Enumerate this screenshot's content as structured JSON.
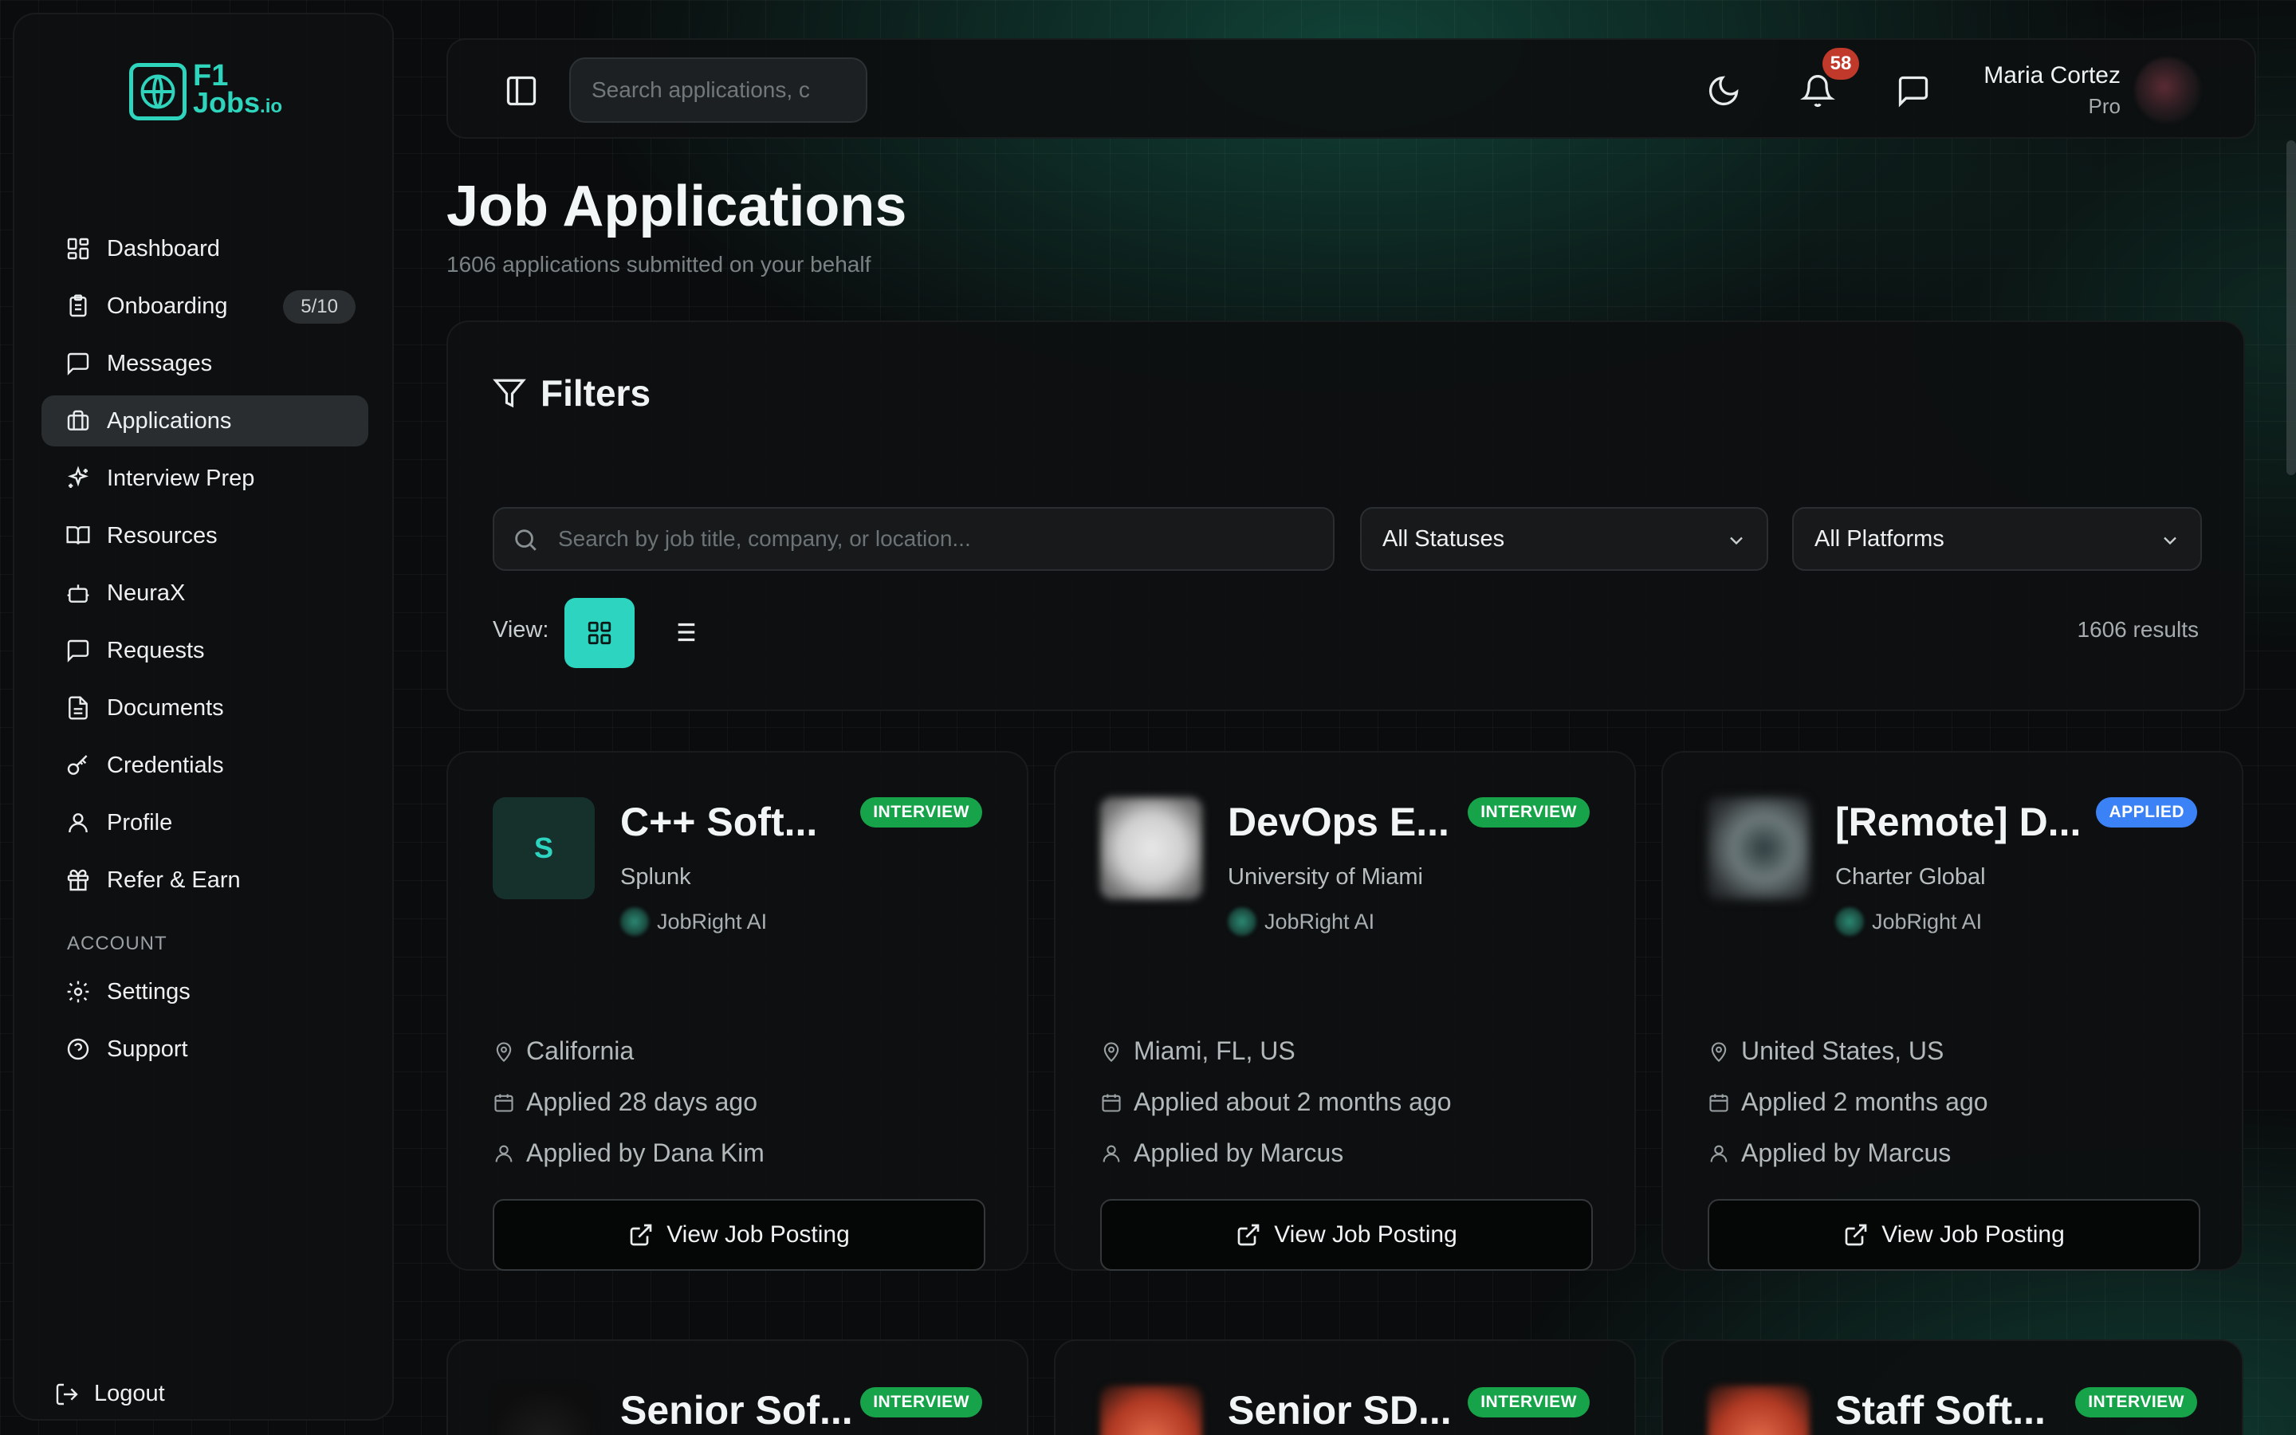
{
  "logo": {
    "line1": "F1",
    "line2": "Jobs",
    "suffix": ".io"
  },
  "sidebar": {
    "items": [
      {
        "label": "Dashboard",
        "icon": "dashboard-icon"
      },
      {
        "label": "Onboarding",
        "icon": "clipboard-icon",
        "badge": "5/10"
      },
      {
        "label": "Messages",
        "icon": "message-icon"
      },
      {
        "label": "Applications",
        "icon": "briefcase-icon",
        "active": true
      },
      {
        "label": "Interview Prep",
        "icon": "sparkles-icon"
      },
      {
        "label": "Resources",
        "icon": "book-icon"
      },
      {
        "label": "NeuraX",
        "icon": "bot-icon"
      },
      {
        "label": "Requests",
        "icon": "message-square-icon"
      },
      {
        "label": "Documents",
        "icon": "file-icon"
      },
      {
        "label": "Credentials",
        "icon": "key-icon"
      },
      {
        "label": "Profile",
        "icon": "user-icon"
      },
      {
        "label": "Refer & Earn",
        "icon": "gift-icon"
      }
    ],
    "account_section": "ACCOUNT",
    "account_items": [
      {
        "label": "Settings",
        "icon": "gear-icon"
      },
      {
        "label": "Support",
        "icon": "help-icon"
      }
    ],
    "logout": "Logout"
  },
  "header": {
    "search_placeholder": "Search applications, c",
    "notifications_count": "58",
    "user_name": "Maria Cortez",
    "user_plan": "Pro"
  },
  "page": {
    "title": "Job Applications",
    "subtitle": "1606 applications submitted on your behalf"
  },
  "filters": {
    "title": "Filters",
    "search_placeholder": "Search by job title, company, or location...",
    "status_select": "All Statuses",
    "platform_select": "All Platforms",
    "view_label": "View:",
    "results": "1606 results"
  },
  "cards": [
    {
      "title": "C++ Soft...",
      "status": "INTERVIEW",
      "company": "Splunk",
      "source": "JobRight AI",
      "logo_letter": "S",
      "location": "California",
      "applied": "Applied 28 days ago",
      "applied_by": "Applied by Dana Kim",
      "button": "View Job Posting"
    },
    {
      "title": "DevOps E...",
      "status": "INTERVIEW",
      "company": "University of Miami",
      "source": "JobRight AI",
      "location": "Miami, FL, US",
      "applied": "Applied about 2 months ago",
      "applied_by": "Applied by Marcus",
      "button": "View Job Posting"
    },
    {
      "title": "[Remote] D...",
      "status": "APPLIED",
      "company": "Charter Global",
      "source": "JobRight AI",
      "location": "United States, US",
      "applied": "Applied 2 months ago",
      "applied_by": "Applied by Marcus",
      "button": "View Job Posting"
    },
    {
      "title": "Senior Sof...",
      "status": "INTERVIEW"
    },
    {
      "title": "Senior SD...",
      "status": "INTERVIEW"
    },
    {
      "title": "Staff Soft...",
      "status": "INTERVIEW"
    }
  ],
  "colors": {
    "accent": "#2dd4bf",
    "interview": "#16a34a",
    "applied": "#3b82f6",
    "notification": "#c0392b"
  }
}
